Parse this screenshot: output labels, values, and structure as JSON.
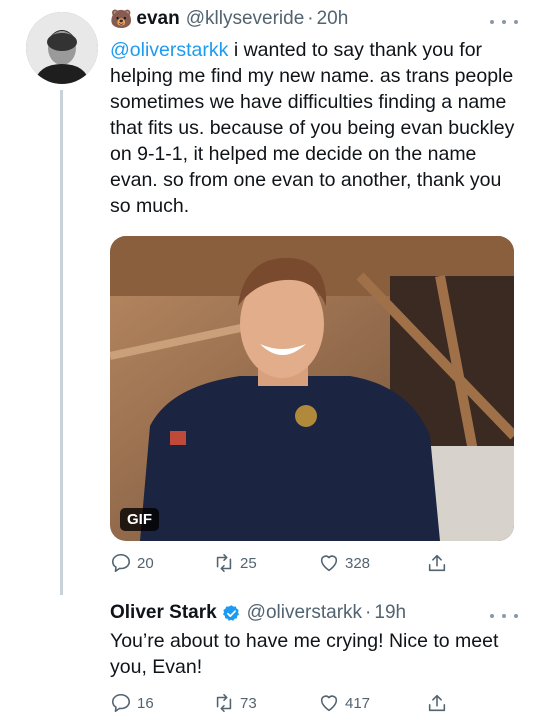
{
  "tweets": [
    {
      "emoji": "🐻",
      "name": "evan",
      "handle": "@kllyseveride",
      "dot": "·",
      "time": "20h",
      "mention": "@oliverstarkk",
      "text": " i wanted to say thank you for helping me find my new name. as trans people sometimes we have difficulties finding a name that fits us. because of you being evan buckley on 9-1-1, it helped me decide on the name evan. so from one evan to another, thank you so much.",
      "media_badge": "GIF",
      "replies": "20",
      "retweets": "25",
      "likes": "328"
    },
    {
      "name": "Oliver Stark",
      "handle": "@oliverstarkk",
      "dot": "·",
      "time": "19h",
      "text": "You’re about to have me crying! Nice to meet you, Evan!",
      "replies": "16",
      "retweets": "73",
      "likes": "417"
    }
  ],
  "colors": {
    "accent": "#1d9bf0",
    "muted": "#536471",
    "thread": "#c9d2d9"
  },
  "icons": [
    "reply-icon",
    "retweet-icon",
    "like-icon",
    "share-icon",
    "more-icon",
    "verified-icon"
  ]
}
